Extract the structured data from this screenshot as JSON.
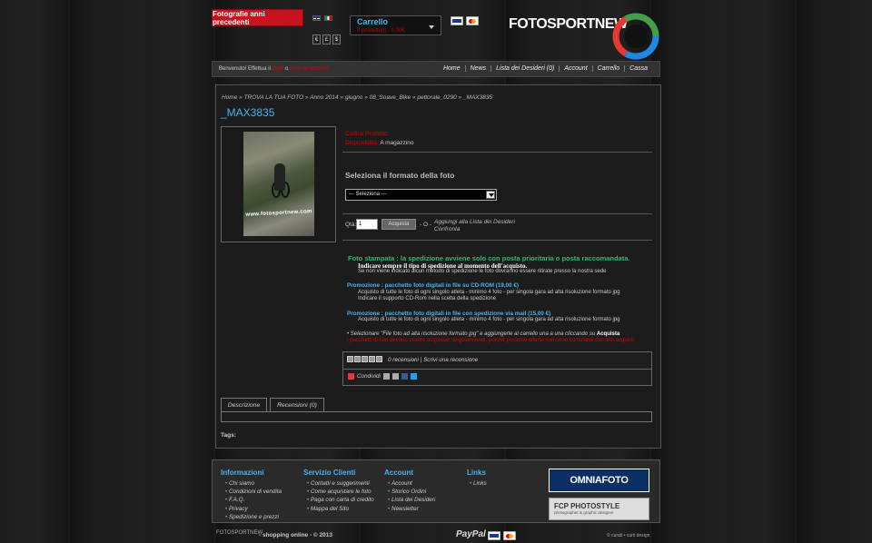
{
  "header": {
    "promo_button": "Fotografie anni precedenti",
    "currencies": [
      "€",
      "£",
      "$"
    ],
    "cart_title": "Carrello",
    "cart_summary": "0 prodotto(i) - 0,00€",
    "logo_text": "FOTOSPORTNEW",
    "welcome_prefix": "Benvenuto! Effettua il",
    "welcome_login": "login",
    "welcome_mid": "o",
    "welcome_register": "crea un account",
    "nav": [
      "Home",
      "News",
      "Lista dei Desideri (0)",
      "Account",
      "Carrello",
      "Cassa"
    ]
  },
  "breadcrumb": "Home » TROVA LA TUA FOTO » Anno 2014 » giugno » 08_Soave_Bike » pettorale_0290 » _MAX3835",
  "product": {
    "title": "_MAX3835",
    "code_label": "Codice Prodotto:",
    "avail_label": "Disponibilità:",
    "avail_value": "A magazzino",
    "image_watermark": "www.fotosportnew.com",
    "format_title": "Seleziona il formato della foto",
    "select_value": "--- Seleziona ---",
    "qty_label": "Qtà:",
    "qty_value": "1",
    "buy_button": "Acquista",
    "or_text": "- O -",
    "wishlist": "Aggiungi alla Lista dei Desideri",
    "compare": "Confronta"
  },
  "description": {
    "shipping_title": "Foto stampata : la spedizione avviene solo con posta prioritaria o posta raccomandata.",
    "shipping_note": "Indicare sempre il tipo di spedizione al momento dell'acquisto.",
    "shipping_sub": "Se non viene indicato alcun metodo di spedizione le foto dovranno essere ritirate presso la nostra sede",
    "promo1_title": "Promozione : pacchetto foto digitali in file su CD-ROM  (19,00 €)",
    "promo1_l1": "Acquisto di tutte le foto di ogni singolo atleta - minimo 4 foto - per singola gara ad alta risoluzione formato jpg",
    "promo1_l2": "Indicare il supporto CD-Rom nella scelta della spedizione",
    "promo2_title": "Promozione : pacchetto foto digitali in file con spedizione via mail  (15,00 €)",
    "promo2_l1": "Acquisto di tutte le foto di ogni singolo atleta - minimo 4 foto - per singola gara ad alta risoluzione formato jpg",
    "note_a": "• Selezionare \"File foto ad alta risoluzione formato jpg\" e aggiungerle al carrello una a una cliccando su",
    "note_a_bold": "Acquista",
    "note_b": "I pacchetti di foto devono essere acquistati singolarmente, poiché possono offerte non sono cumulabili con altri acquisti"
  },
  "reviews": {
    "count": "0 recensioni",
    "sep": "|",
    "write": "Scrivi una recensione",
    "share": "Condividi"
  },
  "tabs": [
    "Descrizione",
    "Recensioni (0)"
  ],
  "tags_label": "Tags:",
  "footer": {
    "col1_title": "Informazioni",
    "col1": [
      "Chi siamo",
      "Condizioni di vendita",
      "F.A.Q.",
      "Privacy",
      "Spedizione e prezzi"
    ],
    "col2_title": "Servizio Clienti",
    "col2": [
      "Contatti e suggerimenti",
      "Come acquistare le foto",
      "Paga con carta di credito",
      "Mappa del Sito"
    ],
    "col3_title": "Account",
    "col3": [
      "Account",
      "Storico Ordini",
      "Lista dei Desideri",
      "Newsletter"
    ],
    "col4_title": "Links",
    "col4": [
      "Links"
    ],
    "banner1": "OMNIAFOTO",
    "banner2": "FCP PHOTOSTYLE",
    "banner2_sub": "photographer & graphic designer",
    "bottom_logo": "FOTOSPORTNEW",
    "shop_text": "- shopping online - © 2013",
    "paypal": "PayPal",
    "credits": "© curati • curti design"
  },
  "colors": {
    "accent_blue": "#4ab3f0",
    "accent_red": "#c8121e",
    "accent_green": "#3cb371"
  }
}
